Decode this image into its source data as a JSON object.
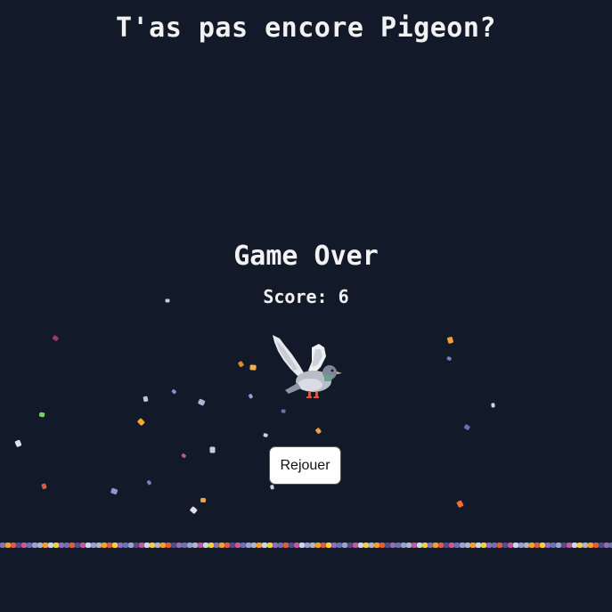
{
  "game": {
    "title": "T'as pas encore Pigeon?",
    "game_over_label": "Game Over",
    "score_label": "Score:",
    "score_value": "6",
    "replay_label": "Rejouer"
  },
  "colors": {
    "background": "#121a29",
    "text": "#f2f2f2",
    "button_bg": "#ffffff"
  },
  "icons": {
    "player": "pigeon-icon",
    "falling": "trash-debris-icon",
    "ground": "trash-pile-icon"
  }
}
